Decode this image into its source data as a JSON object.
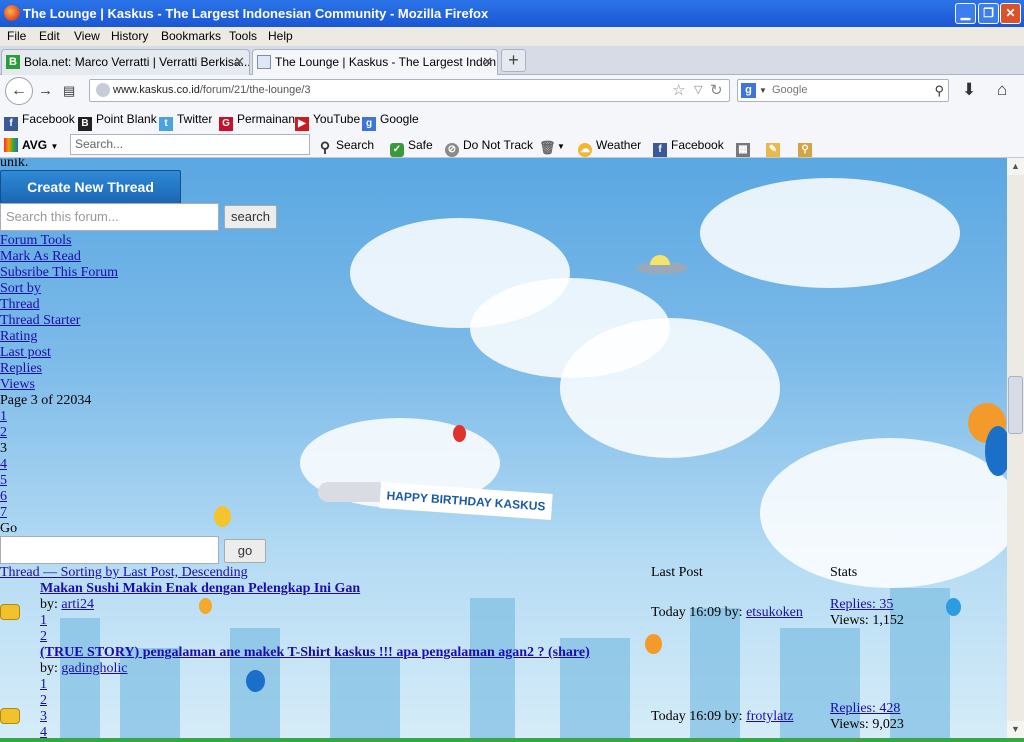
{
  "window": {
    "title": "The Lounge | Kaskus - The Largest Indonesian Community - Mozilla Firefox"
  },
  "menu": [
    "File",
    "Edit",
    "View",
    "History",
    "Bookmarks",
    "Tools",
    "Help"
  ],
  "tabs": [
    {
      "label": "Bola.net: Marco Verratti | Verratti Berkisa..."
    },
    {
      "label": "The Lounge | Kaskus - The Largest Indon..."
    }
  ],
  "nav": {
    "url_domain": "www.kaskus.co.id",
    "url_path": "/forum/21/the-lounge/3",
    "search_placeholder": "Google"
  },
  "bookmarks": [
    "Facebook",
    "Point Blank",
    "Twitter",
    "Permainan",
    "YouTube",
    "Google"
  ],
  "avg": {
    "brand": "AVG",
    "search_placeholder": "Search...",
    "items": [
      "Search",
      "Safe",
      "Do Not Track",
      "Weather",
      "Facebook"
    ]
  },
  "forum": {
    "cut_text": "unik.",
    "create_thread": "Create New Thread",
    "search_placeholder": "Search this forum...",
    "search_button": "search",
    "tools": [
      "Forum Tools",
      "Mark As Read",
      "Subsribe This Forum",
      "Sort by",
      "Thread",
      "Thread Starter",
      "Rating",
      "Last post",
      "Replies",
      "Views"
    ],
    "page_info": "Page 3 of 22034",
    "pages": [
      {
        "n": "1",
        "link": true
      },
      {
        "n": "2",
        "link": true
      },
      {
        "n": "3",
        "link": false
      },
      {
        "n": "4",
        "link": true
      },
      {
        "n": "5",
        "link": true
      },
      {
        "n": "6",
        "link": true
      },
      {
        "n": "7",
        "link": true
      }
    ],
    "go_label": "Go",
    "go_button": "go",
    "sort_header": "Thread — Sorting by Last Post, Descending",
    "col_last_post": "Last Post",
    "col_stats": "Stats",
    "threads": [
      {
        "title": "Makan Sushi Makin Enak dengan Pelengkap Ini Gan",
        "by_label": "by:",
        "author": "arti24",
        "pages": [
          "1",
          "2"
        ],
        "last_post_time": "Today 16:09 by:",
        "last_post_user": "etsukoken",
        "replies": "Replies: 35",
        "views": "Views: 1,152"
      },
      {
        "title": "(TRUE STORY) pengalaman ane makek T-Shirt kaskus !!! apa pengalaman agan2 ? (share)",
        "by_label": "by:",
        "author": "gadingholic",
        "pages": [
          "1",
          "2",
          "3",
          "4"
        ],
        "last_post_time": "Today 16:09 by:",
        "last_post_user": "frotylatz",
        "replies": "Replies: 428",
        "views": "Views: 9,023"
      }
    ]
  },
  "banner_text": "HAPPY BIRTHDAY KASKUS",
  "colors": {
    "title_bar": "#2b74e8",
    "kaskus_button": "#1b66b4",
    "link": "#1a0dab",
    "sky": "#7dbbe9"
  }
}
